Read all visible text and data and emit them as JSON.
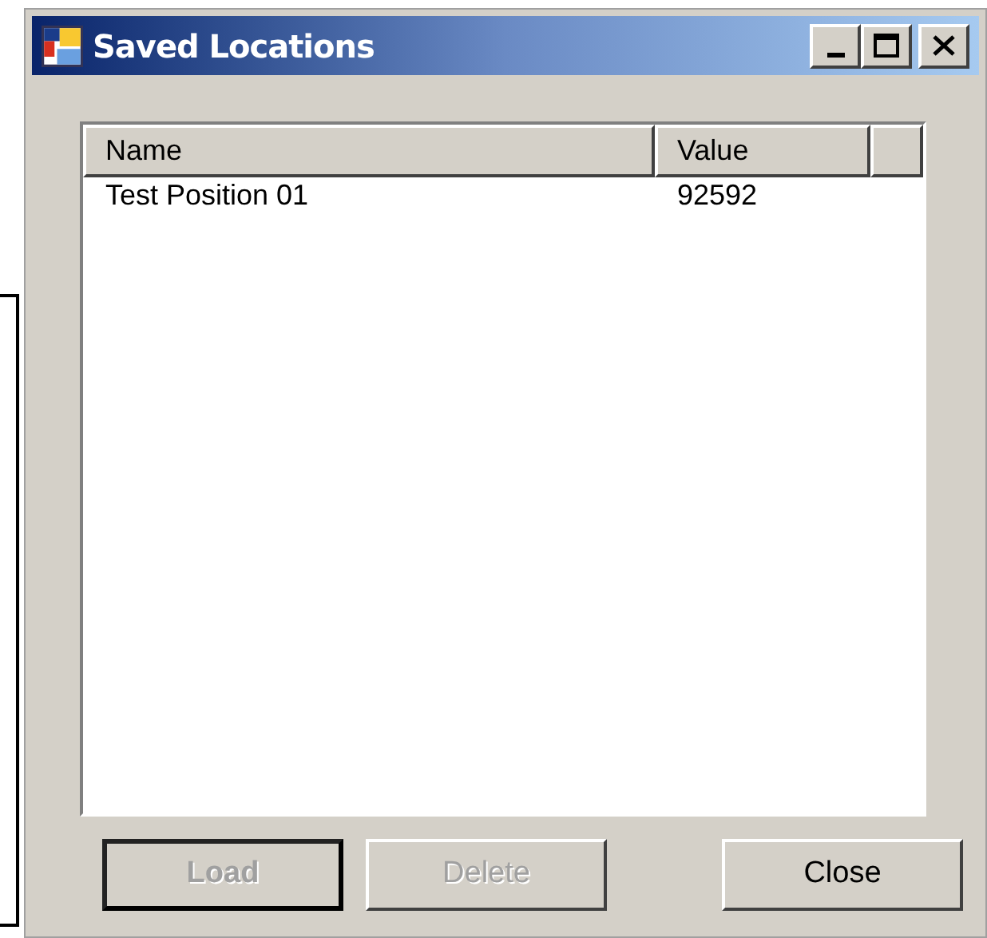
{
  "window": {
    "title": "Saved Locations"
  },
  "list": {
    "columns": [
      "Name",
      "Value"
    ],
    "rows": [
      {
        "name": "Test Position 01",
        "value": "92592"
      }
    ]
  },
  "buttons": [
    {
      "label": "Load",
      "disabled": true,
      "default": true
    },
    {
      "label": "Delete",
      "disabled": true,
      "default": false
    },
    {
      "label": "Close",
      "disabled": false,
      "default": false
    }
  ]
}
